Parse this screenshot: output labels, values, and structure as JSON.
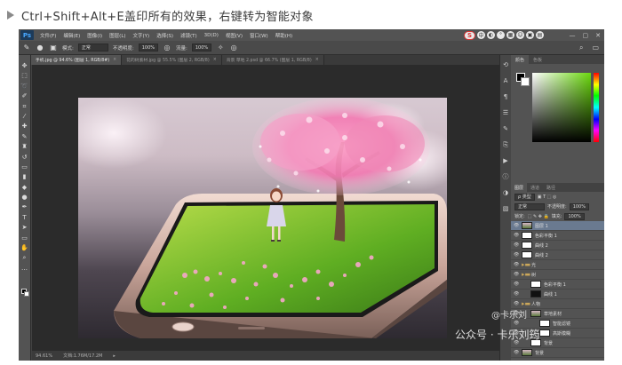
{
  "caption": {
    "text": "Ctrl+Shift+Alt+E盖印所有的效果，右键转为智能对象"
  },
  "app": {
    "logo": "Ps"
  },
  "menubar": {
    "items": [
      "文件(F)",
      "编辑(E)",
      "图像(I)",
      "图层(L)",
      "文字(Y)",
      "选择(S)",
      "滤镜(T)",
      "3D(D)",
      "视图(V)",
      "窗口(W)",
      "帮助(H)"
    ],
    "tray_logo": "S",
    "tray_label": "中"
  },
  "options": {
    "mode_label": "模式:",
    "mode_value": "正常",
    "opacity_label": "不透明度:",
    "opacity_value": "100%",
    "flow_label": "流量:",
    "flow_value": "100%"
  },
  "tabs": [
    {
      "label": "手机.jpg @ 94.6% (图层 1, RGB/8#)",
      "active": true
    },
    {
      "label": "花的树素材.jpg @ 55.5% (图层 2, RGB/8)",
      "active": false
    },
    {
      "label": "背景 草地 2.psd @ 66.7% (图层 1, RGB/8)",
      "active": false
    }
  ],
  "status": {
    "zoom": "94.61%",
    "doc": "文档:1.76M/17.2M"
  },
  "panels": {
    "color_tabs": [
      "颜色",
      "色板"
    ],
    "layer_tabs": [
      "图层",
      "通道",
      "路径"
    ],
    "kind_label": "ρ 类型",
    "blend_mode": "正常",
    "opacity_label": "不透明度:",
    "opacity_value": "100%",
    "lock_label": "锁定:",
    "fill_label": "填充:",
    "fill_value": "100%"
  },
  "layers": [
    {
      "name": "图层 1",
      "type": "photo",
      "selected": true,
      "indent": 0
    },
    {
      "name": "色彩平衡 1",
      "type": "adjust",
      "selected": false,
      "indent": 0
    },
    {
      "name": "曲线 2",
      "type": "adjust",
      "selected": false,
      "indent": 0
    },
    {
      "name": "曲线 2",
      "type": "adjust",
      "selected": false,
      "indent": 0
    },
    {
      "name": "光",
      "type": "folder",
      "selected": false,
      "indent": 0
    },
    {
      "name": "树",
      "type": "folder",
      "selected": false,
      "indent": 0
    },
    {
      "name": "色彩平衡 1",
      "type": "adjust",
      "selected": false,
      "indent": 1
    },
    {
      "name": "曲线 1",
      "type": "mask",
      "selected": false,
      "indent": 1
    },
    {
      "name": "人物",
      "type": "folder",
      "selected": false,
      "indent": 0
    },
    {
      "name": "草地素材",
      "type": "photo",
      "selected": false,
      "indent": 1
    },
    {
      "name": "智能滤镜",
      "type": "adjust",
      "selected": false,
      "indent": 2
    },
    {
      "name": "高斯模糊",
      "type": "adjust",
      "selected": false,
      "indent": 2
    },
    {
      "name": "背景",
      "type": "adjust",
      "selected": false,
      "indent": 1
    },
    {
      "name": "背景",
      "type": "photo",
      "selected": false,
      "indent": 0
    }
  ],
  "watermark": {
    "line1": "@卡乐刘",
    "line2": "公众号 · 卡乐刘筠"
  },
  "colors": {
    "ps_bg": "#424242",
    "panel": "#535353",
    "selected_layer": "#6a7a90",
    "accent_green": "#6bd80e"
  }
}
